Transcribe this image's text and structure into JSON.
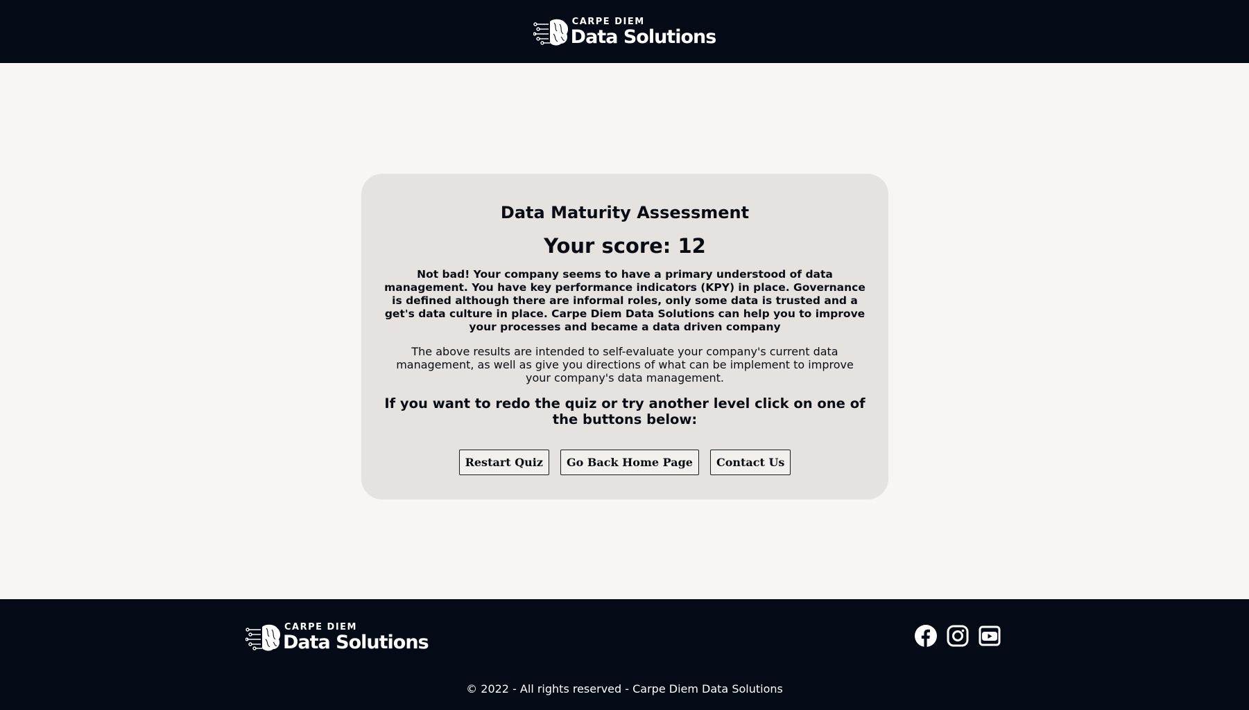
{
  "brand": {
    "small": "CARPE DIEM",
    "big": "Data Solutions"
  },
  "assessment": {
    "title": "Data Maturity Assessment",
    "score_text": "Your score: 12",
    "summary": "Not bad! Your company seems to have a primary understood of data management. You have key performance indicators (KPY) in place. Governance is defined although there are informal roles, only some data is trusted and a get's data culture in place. Carpe Diem Data Solutions can help you to improve your processes and became a data driven company",
    "note": "The above results are intended to self-evaluate your company's current data management, as well as give you directions of what can be implement to improve your company's data management.",
    "cta": "If you want to redo the quiz or try another level click on one of the buttons below:"
  },
  "buttons": {
    "restart": "Restart Quiz",
    "home": "Go Back Home Page",
    "contact": "Contact Us"
  },
  "footer": {
    "social_icons": [
      "facebook-icon",
      "instagram-icon",
      "youtube-icon"
    ],
    "copyright": "© 2022 - All rights reserved - Carpe Diem Data Solutions"
  },
  "colors": {
    "header_bg": "#050a17",
    "page_bg": "#f7f6f3",
    "card_bg": "#e5e2df"
  }
}
